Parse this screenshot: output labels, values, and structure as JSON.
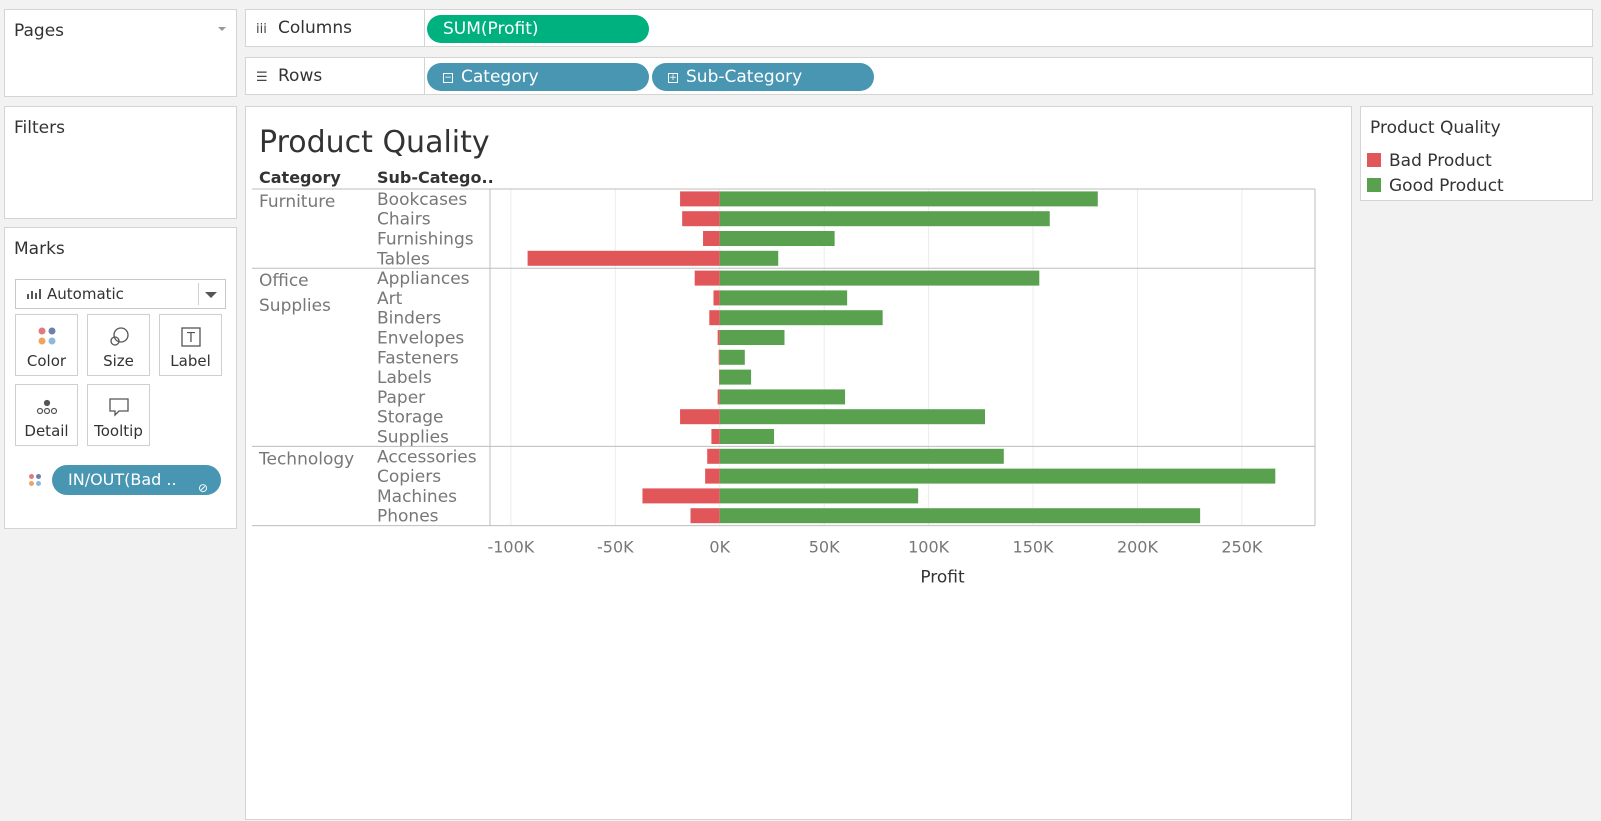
{
  "pages": {
    "title": "Pages"
  },
  "filters": {
    "title": "Filters"
  },
  "marks": {
    "title": "Marks",
    "mark_type": "Automatic",
    "buttons": [
      {
        "label": "Color",
        "icon": "color-dots-icon"
      },
      {
        "label": "Size",
        "icon": "size-icon"
      },
      {
        "label": "Label",
        "icon": "label-icon"
      },
      {
        "label": "Detail",
        "icon": "detail-icon"
      },
      {
        "label": "Tooltip",
        "icon": "tooltip-icon"
      }
    ],
    "field_pill": "IN/OUT(Bad .."
  },
  "shelves": {
    "columns": {
      "label": "Columns",
      "pills": [
        "SUM(Profit)"
      ]
    },
    "rows": {
      "label": "Rows",
      "pills": [
        "Category",
        "Sub-Category"
      ]
    }
  },
  "legend": {
    "title": "Product Quality",
    "items": [
      {
        "label": "Bad Product",
        "color": "#e15759"
      },
      {
        "label": "Good Product",
        "color": "#59a14f"
      }
    ]
  },
  "chart_data": {
    "type": "bar",
    "orientation": "horizontal",
    "title": "Product Quality",
    "xlabel": "Profit",
    "row_headers": [
      "Category",
      "Sub-Catego.."
    ],
    "xlim": [
      -110000,
      285000
    ],
    "x_ticks": [
      -100000,
      -50000,
      0,
      50000,
      100000,
      150000,
      200000,
      250000
    ],
    "x_tick_labels": [
      "-100K",
      "-50K",
      "0K",
      "50K",
      "100K",
      "150K",
      "200K",
      "250K"
    ],
    "grid": true,
    "groups": [
      {
        "category": "Furniture",
        "rows": [
          {
            "sub": "Bookcases",
            "bad": -19000,
            "good": 181000
          },
          {
            "sub": "Chairs",
            "bad": -18000,
            "good": 158000
          },
          {
            "sub": "Furnishings",
            "bad": -8000,
            "good": 55000
          },
          {
            "sub": "Tables",
            "bad": -92000,
            "good": 28000
          }
        ]
      },
      {
        "category": "Office Supplies",
        "rows": [
          {
            "sub": "Appliances",
            "bad": -12000,
            "good": 153000
          },
          {
            "sub": "Art",
            "bad": -3000,
            "good": 61000
          },
          {
            "sub": "Binders",
            "bad": -5000,
            "good": 78000
          },
          {
            "sub": "Envelopes",
            "bad": -1000,
            "good": 31000
          },
          {
            "sub": "Fasteners",
            "bad": -500,
            "good": 12000
          },
          {
            "sub": "Labels",
            "bad": -300,
            "good": 15000
          },
          {
            "sub": "Paper",
            "bad": -1000,
            "good": 60000
          },
          {
            "sub": "Storage",
            "bad": -19000,
            "good": 127000
          },
          {
            "sub": "Supplies",
            "bad": -4000,
            "good": 26000
          }
        ]
      },
      {
        "category": "Technology",
        "rows": [
          {
            "sub": "Accessories",
            "bad": -6000,
            "good": 136000
          },
          {
            "sub": "Copiers",
            "bad": -7000,
            "good": 266000
          },
          {
            "sub": "Machines",
            "bad": -37000,
            "good": 95000
          },
          {
            "sub": "Phones",
            "bad": -14000,
            "good": 230000
          }
        ]
      }
    ],
    "series": [
      {
        "name": "Bad Product",
        "color": "#e15759"
      },
      {
        "name": "Good Product",
        "color": "#59a14f"
      }
    ]
  }
}
